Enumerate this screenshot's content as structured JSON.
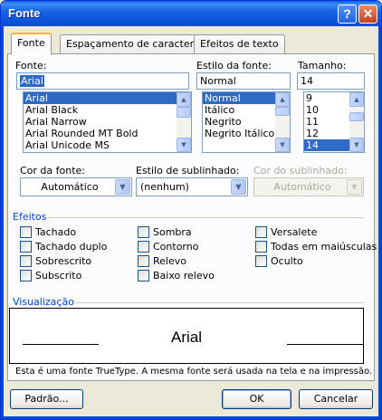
{
  "window": {
    "title": "Fonte"
  },
  "titlebar": {
    "help_glyph": "?",
    "close_glyph": "✕"
  },
  "tabs": [
    {
      "label": "Fonte",
      "active": true
    },
    {
      "label": "Espaçamento de caracteres",
      "active": false
    },
    {
      "label": "Efeitos de texto",
      "active": false
    }
  ],
  "font": {
    "label": "Fonte:",
    "value": "Arial",
    "items": [
      "Arial",
      "Arial Black",
      "Arial Narrow",
      "Arial Rounded MT Bold",
      "Arial Unicode MS"
    ],
    "selected": "Arial"
  },
  "style": {
    "label": "Estilo da fonte:",
    "value": "Normal",
    "items": [
      "Normal",
      "Itálico",
      "Negrito",
      "Negrito Itálico"
    ],
    "selected": "Normal"
  },
  "size": {
    "label": "Tamanho:",
    "value": "14",
    "items": [
      "9",
      "10",
      "11",
      "12",
      "14"
    ],
    "selected": "14"
  },
  "font_color": {
    "label": "Cor da fonte:",
    "value": "Automático"
  },
  "underline_style": {
    "label": "Estilo de sublinhado:",
    "value": "(nenhum)"
  },
  "underline_color": {
    "label": "Cor do sublinhado:",
    "value": "Automático",
    "enabled": false
  },
  "effects": {
    "title": "Efeitos",
    "items": [
      {
        "label": "Tachado",
        "checked": false
      },
      {
        "label": "Tachado duplo",
        "checked": false
      },
      {
        "label": "Sobrescrito",
        "checked": false
      },
      {
        "label": "Subscrito",
        "checked": false
      },
      {
        "label": "Sombra",
        "checked": false
      },
      {
        "label": "Contorno",
        "checked": false
      },
      {
        "label": "Relevo",
        "checked": false
      },
      {
        "label": "Baixo relevo",
        "checked": false
      },
      {
        "label": "Versalete",
        "checked": false
      },
      {
        "label": "Todas em maiúsculas",
        "checked": false
      },
      {
        "label": "Oculto",
        "checked": false
      }
    ]
  },
  "preview": {
    "title": "Visualização",
    "sample": "Arial"
  },
  "note": "Esta é uma fonte TrueType. A mesma fonte será usada na tela e na impressão.",
  "buttons": {
    "default": "Padrão...",
    "ok": "OK",
    "cancel": "Cancelar"
  },
  "colors": {
    "titlebar": "#0a5fe0",
    "selection": "#316ac5",
    "group_title": "#0046d5",
    "dialog_bg": "#ece9d8"
  }
}
